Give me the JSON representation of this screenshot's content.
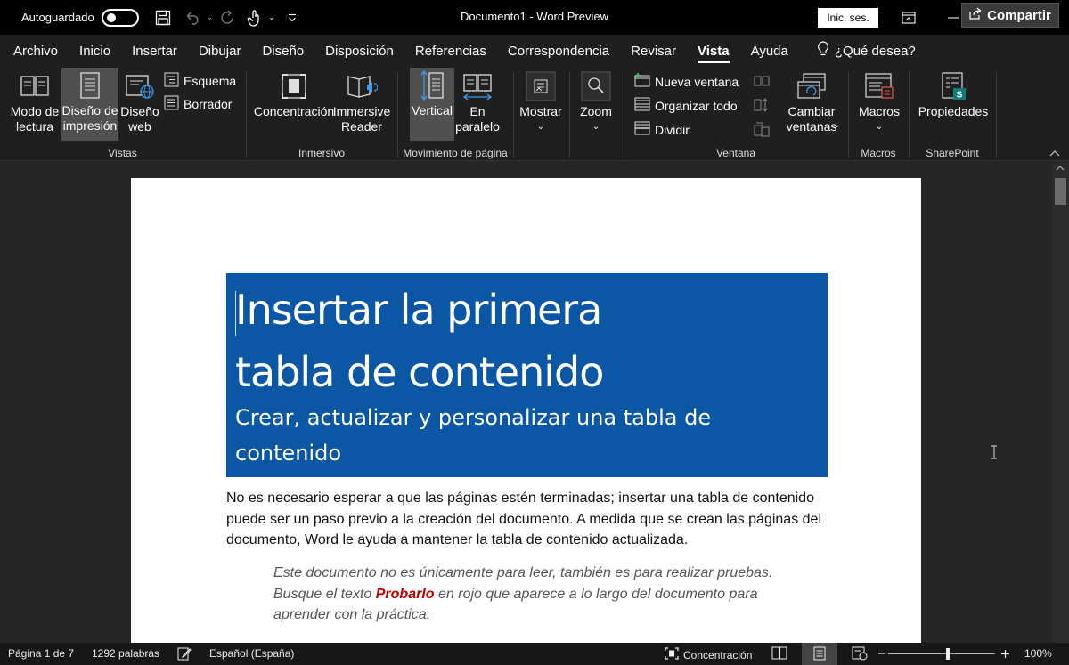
{
  "titlebar": {
    "autosave_label": "Autoguardado",
    "doc_title": "Documento1  -  Word Preview",
    "signin_label": "Inic. ses."
  },
  "menu": {
    "tabs": [
      "Archivo",
      "Inicio",
      "Insertar",
      "Dibujar",
      "Diseño",
      "Disposición",
      "Referencias",
      "Correspondencia",
      "Revisar",
      "Vista",
      "Ayuda"
    ],
    "active_tab": "Vista",
    "tell_me": "¿Qué desea?",
    "share_label": "Compartir"
  },
  "ribbon": {
    "vistas": {
      "group_label": "Vistas",
      "modo_lectura": "Modo de lectura",
      "diseno_impresion": "Diseño de impresión",
      "diseno_web": "Diseño web",
      "esquema": "Esquema",
      "borrador": "Borrador"
    },
    "inmersivo": {
      "group_label": "Inmersivo",
      "concentracion": "Concentración",
      "immersive_reader": "Immersive Reader"
    },
    "movimiento": {
      "group_label": "Movimiento de página",
      "vertical": "Vertical",
      "en_paralelo": "En paralelo"
    },
    "mostrar": "Mostrar",
    "zoom": "Zoom",
    "ventana": {
      "group_label": "Ventana",
      "nueva_ventana": "Nueva ventana",
      "organizar_todo": "Organizar todo",
      "dividir": "Dividir",
      "cambiar_ventanas": "Cambiar ventanas"
    },
    "macros": {
      "group_label": "Macros",
      "macros": "Macros"
    },
    "sharepoint": {
      "group_label": "SharePoint",
      "propiedades": "Propiedades"
    }
  },
  "document": {
    "title_line1": "Insertar la primera",
    "title_line2": "tabla de contenido",
    "subtitle": "Crear, actualizar y personalizar una tabla de contenido",
    "body": "No es necesario esperar a que las páginas estén terminadas; insertar una tabla de contenido puede ser un paso previo a la creación del documento. A medida que se crean las páginas del documento, Word le ayuda a mantener la tabla de contenido actualizada.",
    "quote_part1": "Este documento no es únicamente para leer, también es para realizar pruebas. Busque el texto ",
    "quote_highlight": "Probarlo",
    "quote_part2": " en rojo que aparece a lo largo del documento para aprender con la práctica."
  },
  "statusbar": {
    "page": "Página 1 de 7",
    "words": "1292 palabras",
    "language": "Español (España)",
    "focus": "Concentración",
    "zoom_level": "100%"
  },
  "colors": {
    "title_block": "#0b57a4",
    "accent_red": "#c00000"
  }
}
